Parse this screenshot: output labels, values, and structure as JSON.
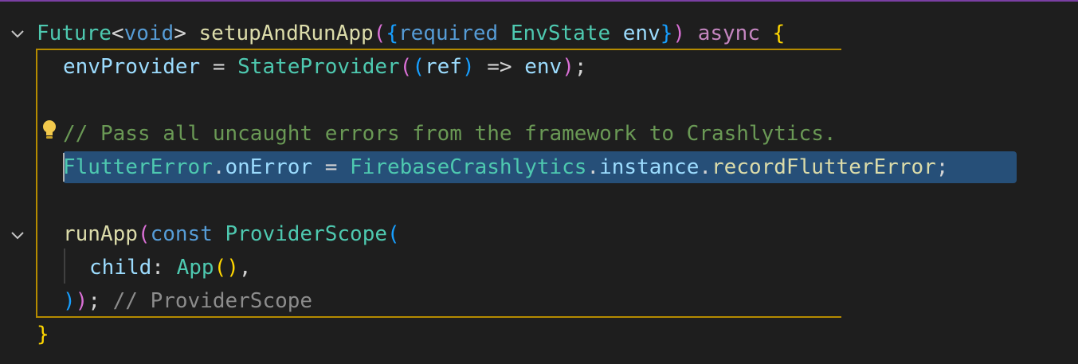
{
  "editor": {
    "language": "dart",
    "selected_line": 5,
    "lines": [
      {
        "tokens": [
          {
            "text": "Future",
            "role": "type"
          },
          {
            "text": "<",
            "role": "punc"
          },
          {
            "text": "void",
            "role": "kw"
          },
          {
            "text": "> ",
            "role": "punc"
          },
          {
            "text": "setupAndRunApp",
            "role": "fn"
          },
          {
            "text": "(",
            "role": "b2"
          },
          {
            "text": "{",
            "role": "b3"
          },
          {
            "text": "required",
            "role": "kw"
          },
          {
            "text": " ",
            "role": "punc"
          },
          {
            "text": "EnvState",
            "role": "type"
          },
          {
            "text": " env",
            "role": "var"
          },
          {
            "text": "}",
            "role": "b3"
          },
          {
            "text": ")",
            "role": "b2"
          },
          {
            "text": " ",
            "role": "punc"
          },
          {
            "text": "async",
            "role": "ctrl"
          },
          {
            "text": " ",
            "role": "punc"
          },
          {
            "text": "{",
            "role": "b1"
          }
        ]
      },
      {
        "tokens": [
          {
            "text": "envProvider",
            "role": "var"
          },
          {
            "text": " = ",
            "role": "punc"
          },
          {
            "text": "StateProvider",
            "role": "type"
          },
          {
            "text": "(",
            "role": "b2"
          },
          {
            "text": "(",
            "role": "b3"
          },
          {
            "text": "ref",
            "role": "var"
          },
          {
            "text": ")",
            "role": "b3"
          },
          {
            "text": " => ",
            "role": "punc"
          },
          {
            "text": "env",
            "role": "var"
          },
          {
            "text": ")",
            "role": "b2"
          },
          {
            "text": ";",
            "role": "punc"
          }
        ]
      },
      {
        "tokens": []
      },
      {
        "tokens": [
          {
            "text": "// Pass all uncaught errors from the framework to Crashlytics.",
            "role": "comment"
          }
        ]
      },
      {
        "tokens": [
          {
            "text": "FlutterError",
            "role": "type"
          },
          {
            "text": ".",
            "role": "punc"
          },
          {
            "text": "onError",
            "role": "var"
          },
          {
            "text": " = ",
            "role": "punc"
          },
          {
            "text": "FirebaseCrashlytics",
            "role": "type"
          },
          {
            "text": ".",
            "role": "punc"
          },
          {
            "text": "instance",
            "role": "var"
          },
          {
            "text": ".",
            "role": "punc"
          },
          {
            "text": "recordFlutterError",
            "role": "fn"
          },
          {
            "text": ";",
            "role": "punc"
          }
        ]
      },
      {
        "tokens": []
      },
      {
        "tokens": [
          {
            "text": "runApp",
            "role": "fn"
          },
          {
            "text": "(",
            "role": "b2"
          },
          {
            "text": "const",
            "role": "kw"
          },
          {
            "text": " ",
            "role": "punc"
          },
          {
            "text": "ProviderScope",
            "role": "type"
          },
          {
            "text": "(",
            "role": "b3"
          }
        ]
      },
      {
        "tokens": [
          {
            "text": "child",
            "role": "var"
          },
          {
            "text": ": ",
            "role": "punc"
          },
          {
            "text": "App",
            "role": "type"
          },
          {
            "text": "()",
            "role": "b1"
          },
          {
            "text": ",",
            "role": "punc"
          }
        ]
      },
      {
        "tokens": [
          {
            "text": ")",
            "role": "b3"
          },
          {
            "text": ")",
            "role": "b2"
          },
          {
            "text": ";",
            "role": "punc"
          },
          {
            "text": " // ProviderScope",
            "role": "ghost"
          }
        ]
      },
      {
        "tokens": [
          {
            "text": "}",
            "role": "b1"
          }
        ]
      }
    ]
  },
  "icons": {
    "fold": "chevron-down-icon",
    "lightbulb": "lightbulb-icon"
  },
  "colors": {
    "background": "#1e1e1e",
    "selection": "#264f78",
    "scope_guide": "#b58b00",
    "lightbulb": "#f2c94c"
  }
}
